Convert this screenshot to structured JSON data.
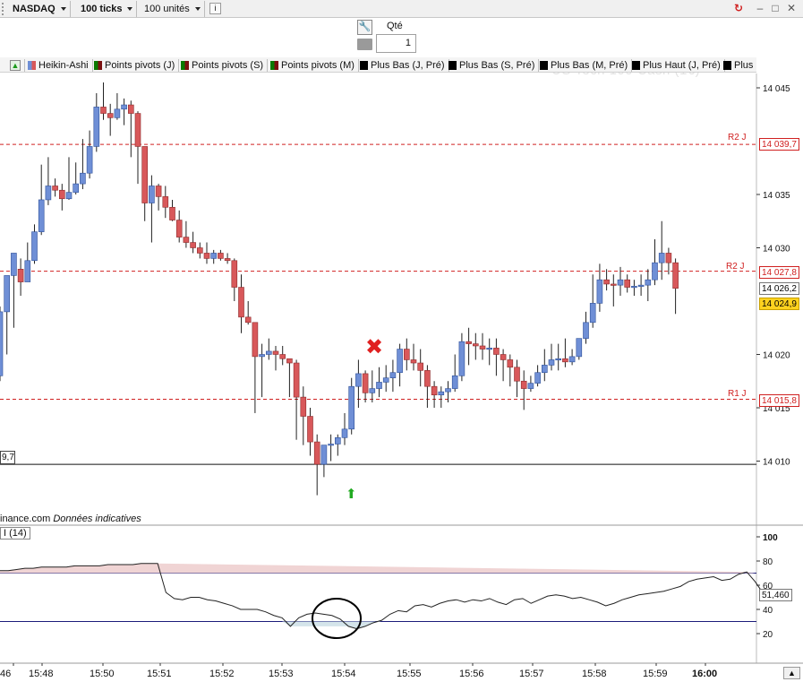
{
  "toolbar": {
    "instrument": "NASDAQ",
    "ticks": "100 ticks",
    "units": "100 unités"
  },
  "order_panel": {
    "qty_label": "Qté",
    "qty_value": "1"
  },
  "legend": {
    "items": [
      "Heikin-Ashi",
      "Points pivots (J)",
      "Points pivots (S)",
      "Points pivots (M)",
      "Plus Bas (J, Pré)",
      "Plus Bas (S, Pré)",
      "Plus Bas (M, Pré)",
      "Plus Haut (J, Pré)",
      "Plus"
    ]
  },
  "watermark": "US Tech 100 Cash (1€)",
  "source": {
    "site": "inance.com",
    "note": "Données indicatives"
  },
  "rsi_label": "I (14)",
  "left_value": "9,7",
  "chart_data": {
    "type": "candlestick",
    "price_axis": {
      "ticks": [
        "14 045",
        "14 035",
        "14 030",
        "14 020",
        "14 015",
        "14 010"
      ],
      "tick_values": [
        14045,
        14035,
        14030,
        14020,
        14015,
        14010
      ]
    },
    "pivots": [
      {
        "name": "R2 J",
        "value": 14039.7,
        "label": "14 039,7"
      },
      {
        "name": "R2 J",
        "value": 14027.8,
        "label": "14 027,8"
      },
      {
        "name": "R1 J",
        "value": 14015.8,
        "label": "14 015,8"
      }
    ],
    "horizontal_line": {
      "value": 14009.7
    },
    "last_price": {
      "value": 14024.9,
      "label": "14 024,9"
    },
    "prev_price": {
      "value": 14026.2,
      "label": "14 026,2"
    },
    "time_labels": [
      "46",
      "15:48",
      "15:50",
      "15:51",
      "15:52",
      "15:53",
      "15:54",
      "15:55",
      "15:56",
      "15:57",
      "15:58",
      "15:59",
      "16:00"
    ],
    "candles": [
      {
        "o": 14018.0,
        "h": 14024.5,
        "l": 14017.5,
        "c": 14024.0
      },
      {
        "o": 14024.0,
        "h": 14027.2,
        "l": 14020.0,
        "c": 14027.4
      },
      {
        "o": 14027.4,
        "h": 14029.5,
        "l": 14022.5,
        "c": 14029.5
      },
      {
        "o": 14028.0,
        "h": 14029.0,
        "l": 14025.5,
        "c": 14026.8
      },
      {
        "o": 14026.8,
        "h": 14030.5,
        "l": 14027.0,
        "c": 14028.8
      },
      {
        "o": 14028.8,
        "h": 14032.2,
        "l": 14028.5,
        "c": 14031.5
      },
      {
        "o": 14031.5,
        "h": 14037.8,
        "l": 14031.2,
        "c": 14034.5
      },
      {
        "o": 14034.5,
        "h": 14038.5,
        "l": 14034.0,
        "c": 14035.8
      },
      {
        "o": 14035.8,
        "h": 14036.5,
        "l": 14034.8,
        "c": 14035.4
      },
      {
        "o": 14035.4,
        "h": 14036.0,
        "l": 14033.5,
        "c": 14034.6
      },
      {
        "o": 14034.6,
        "h": 14038.5,
        "l": 14034.5,
        "c": 14035.2
      },
      {
        "o": 14035.2,
        "h": 14038.0,
        "l": 14035.0,
        "c": 14036.0
      },
      {
        "o": 14036.0,
        "h": 14040.2,
        "l": 14035.5,
        "c": 14037.0
      },
      {
        "o": 14037.0,
        "h": 14041.0,
        "l": 14036.5,
        "c": 14039.5
      },
      {
        "o": 14039.5,
        "h": 14044.5,
        "l": 14039.0,
        "c": 14043.2
      },
      {
        "o": 14043.2,
        "h": 14045.5,
        "l": 14042.0,
        "c": 14042.6
      },
      {
        "o": 14042.6,
        "h": 14043.5,
        "l": 14040.5,
        "c": 14042.2
      },
      {
        "o": 14042.2,
        "h": 14044.5,
        "l": 14042.0,
        "c": 14043.0
      },
      {
        "o": 14043.0,
        "h": 14044.0,
        "l": 14041.5,
        "c": 14043.4
      },
      {
        "o": 14043.4,
        "h": 14043.8,
        "l": 14038.5,
        "c": 14042.6
      },
      {
        "o": 14042.6,
        "h": 14042.8,
        "l": 14036.0,
        "c": 14039.5
      },
      {
        "o": 14039.5,
        "h": 14039.5,
        "l": 14032.5,
        "c": 14034.2
      },
      {
        "o": 14034.2,
        "h": 14036.8,
        "l": 14030.5,
        "c": 14035.8
      },
      {
        "o": 14035.8,
        "h": 14036.0,
        "l": 14033.5,
        "c": 14034.8
      },
      {
        "o": 14034.8,
        "h": 14035.8,
        "l": 14032.8,
        "c": 14033.8
      },
      {
        "o": 14033.8,
        "h": 14034.5,
        "l": 14032.5,
        "c": 14032.6
      },
      {
        "o": 14032.6,
        "h": 14033.5,
        "l": 14030.5,
        "c": 14031.0
      },
      {
        "o": 14031.0,
        "h": 14032.5,
        "l": 14030.0,
        "c": 14030.5
      },
      {
        "o": 14030.5,
        "h": 14031.5,
        "l": 14029.5,
        "c": 14030.0
      },
      {
        "o": 14030.0,
        "h": 14030.5,
        "l": 14029.0,
        "c": 14029.5
      },
      {
        "o": 14029.5,
        "h": 14030.5,
        "l": 14028.5,
        "c": 14029.0
      },
      {
        "o": 14029.0,
        "h": 14029.8,
        "l": 14028.5,
        "c": 14029.5
      },
      {
        "o": 14029.5,
        "h": 14029.8,
        "l": 14028.8,
        "c": 14029.0
      },
      {
        "o": 14029.0,
        "h": 14029.5,
        "l": 14028.5,
        "c": 14028.8
      },
      {
        "o": 14028.8,
        "h": 14029.0,
        "l": 14025.0,
        "c": 14026.3
      },
      {
        "o": 14026.3,
        "h": 14027.5,
        "l": 14022.0,
        "c": 14023.5
      },
      {
        "o": 14023.5,
        "h": 14025.0,
        "l": 14022.8,
        "c": 14023.0
      },
      {
        "o": 14023.0,
        "h": 14023.0,
        "l": 14014.5,
        "c": 14019.8
      },
      {
        "o": 14019.8,
        "h": 14021.0,
        "l": 14016.0,
        "c": 14020.0
      },
      {
        "o": 14020.0,
        "h": 14021.5,
        "l": 14019.5,
        "c": 14020.3
      },
      {
        "o": 14020.3,
        "h": 14020.8,
        "l": 14018.5,
        "c": 14020.0
      },
      {
        "o": 14020.0,
        "h": 14020.8,
        "l": 14019.0,
        "c": 14019.6
      },
      {
        "o": 14019.6,
        "h": 14019.6,
        "l": 14016.0,
        "c": 14019.2
      },
      {
        "o": 14019.2,
        "h": 14019.5,
        "l": 14012.0,
        "c": 14016.0
      },
      {
        "o": 14016.0,
        "h": 14017.0,
        "l": 14011.5,
        "c": 14014.2
      },
      {
        "o": 14014.2,
        "h": 14015.0,
        "l": 14010.5,
        "c": 14011.8
      },
      {
        "o": 14011.8,
        "h": 14012.5,
        "l": 14006.8,
        "c": 14009.7
      },
      {
        "o": 14009.7,
        "h": 14011.5,
        "l": 14008.5,
        "c": 14011.5
      },
      {
        "o": 14011.5,
        "h": 14012.5,
        "l": 14010.0,
        "c": 14011.6
      },
      {
        "o": 14011.6,
        "h": 14012.5,
        "l": 14010.5,
        "c": 14012.2
      },
      {
        "o": 14012.2,
        "h": 14014.5,
        "l": 14011.5,
        "c": 14013.0
      },
      {
        "o": 14013.0,
        "h": 14017.8,
        "l": 14012.5,
        "c": 14017.0
      },
      {
        "o": 14017.0,
        "h": 14019.5,
        "l": 14015.0,
        "c": 14018.2
      },
      {
        "o": 14018.2,
        "h": 14018.5,
        "l": 14015.5,
        "c": 14016.4
      },
      {
        "o": 14016.4,
        "h": 14018.5,
        "l": 14015.5,
        "c": 14016.8
      },
      {
        "o": 14016.8,
        "h": 14018.8,
        "l": 14016.0,
        "c": 14017.4
      },
      {
        "o": 14017.4,
        "h": 14019.0,
        "l": 14016.5,
        "c": 14017.8
      },
      {
        "o": 14017.8,
        "h": 14019.5,
        "l": 14016.5,
        "c": 14018.3
      },
      {
        "o": 14018.3,
        "h": 14021.0,
        "l": 14017.0,
        "c": 14020.5
      },
      {
        "o": 14020.5,
        "h": 14021.5,
        "l": 14018.5,
        "c": 14019.5
      },
      {
        "o": 14019.5,
        "h": 14021.0,
        "l": 14018.5,
        "c": 14019.2
      },
      {
        "o": 14019.2,
        "h": 14020.5,
        "l": 14017.0,
        "c": 14018.5
      },
      {
        "o": 14018.5,
        "h": 14019.0,
        "l": 14015.0,
        "c": 14017.0
      },
      {
        "o": 14017.0,
        "h": 14017.5,
        "l": 14015.0,
        "c": 14016.2
      },
      {
        "o": 14016.2,
        "h": 14017.0,
        "l": 14015.0,
        "c": 14016.5
      },
      {
        "o": 14016.5,
        "h": 14017.5,
        "l": 14015.5,
        "c": 14016.8
      },
      {
        "o": 14016.8,
        "h": 14020.0,
        "l": 14016.5,
        "c": 14018.0
      },
      {
        "o": 14018.0,
        "h": 14022.0,
        "l": 14017.5,
        "c": 14021.2
      },
      {
        "o": 14021.2,
        "h": 14022.5,
        "l": 14019.0,
        "c": 14021.0
      },
      {
        "o": 14021.0,
        "h": 14022.0,
        "l": 14019.5,
        "c": 14020.8
      },
      {
        "o": 14020.8,
        "h": 14022.0,
        "l": 14019.5,
        "c": 14020.5
      },
      {
        "o": 14020.5,
        "h": 14021.5,
        "l": 14019.0,
        "c": 14020.6
      },
      {
        "o": 14020.6,
        "h": 14021.5,
        "l": 14018.0,
        "c": 14020.0
      },
      {
        "o": 14020.0,
        "h": 14020.5,
        "l": 14017.5,
        "c": 14019.5
      },
      {
        "o": 14019.5,
        "h": 14020.0,
        "l": 14017.0,
        "c": 14018.8
      },
      {
        "o": 14018.8,
        "h": 14019.5,
        "l": 14016.0,
        "c": 14017.5
      },
      {
        "o": 14017.5,
        "h": 14018.5,
        "l": 14014.8,
        "c": 14016.8
      },
      {
        "o": 14016.8,
        "h": 14018.0,
        "l": 14016.5,
        "c": 14017.3
      },
      {
        "o": 14017.3,
        "h": 14019.0,
        "l": 14017.0,
        "c": 14018.3
      },
      {
        "o": 14018.3,
        "h": 14020.5,
        "l": 14017.5,
        "c": 14019.0
      },
      {
        "o": 14019.0,
        "h": 14021.0,
        "l": 14018.5,
        "c": 14019.5
      },
      {
        "o": 14019.5,
        "h": 14021.0,
        "l": 14018.5,
        "c": 14019.6
      },
      {
        "o": 14019.6,
        "h": 14021.5,
        "l": 14018.8,
        "c": 14019.3
      },
      {
        "o": 14019.3,
        "h": 14020.5,
        "l": 14019.0,
        "c": 14019.8
      },
      {
        "o": 14019.8,
        "h": 14021.5,
        "l": 14019.5,
        "c": 14021.5
      },
      {
        "o": 14021.5,
        "h": 14024.0,
        "l": 14021.0,
        "c": 14023.0
      },
      {
        "o": 14023.0,
        "h": 14027.5,
        "l": 14022.5,
        "c": 14024.8
      },
      {
        "o": 14024.8,
        "h": 14028.5,
        "l": 14024.0,
        "c": 14027.0
      },
      {
        "o": 14027.0,
        "h": 14028.0,
        "l": 14026.0,
        "c": 14026.6
      },
      {
        "o": 14026.6,
        "h": 14027.5,
        "l": 14024.5,
        "c": 14026.5
      },
      {
        "o": 14026.5,
        "h": 14028.2,
        "l": 14025.5,
        "c": 14027.0
      },
      {
        "o": 14027.0,
        "h": 14027.5,
        "l": 14025.8,
        "c": 14026.3
      },
      {
        "o": 14026.3,
        "h": 14027.0,
        "l": 14025.5,
        "c": 14026.4
      },
      {
        "o": 14026.4,
        "h": 14027.5,
        "l": 14025.5,
        "c": 14026.5
      },
      {
        "o": 14026.5,
        "h": 14028.0,
        "l": 14025.0,
        "c": 14027.0
      },
      {
        "o": 14027.0,
        "h": 14030.8,
        "l": 14026.5,
        "c": 14028.6
      },
      {
        "o": 14028.6,
        "h": 14032.5,
        "l": 14027.0,
        "c": 14029.5
      },
      {
        "o": 14029.5,
        "h": 14030.0,
        "l": 14027.5,
        "c": 14028.6
      },
      {
        "o": 14028.6,
        "h": 14029.0,
        "l": 14023.8,
        "c": 14026.2
      }
    ],
    "rsi": {
      "period": 14,
      "ticks": [
        100,
        80,
        60,
        40,
        20
      ],
      "upper": 70,
      "lower": 30,
      "value_label": "51,460",
      "values": [
        72,
        72,
        73,
        74,
        74,
        75,
        75,
        75,
        75,
        76,
        76,
        76,
        76,
        77,
        77,
        77,
        77,
        78,
        78,
        78,
        54,
        49,
        48,
        50,
        50,
        48,
        47,
        45,
        43,
        40,
        40,
        40,
        38,
        35,
        33,
        26,
        33,
        36,
        37,
        36,
        35,
        32,
        26,
        24,
        26,
        29,
        31,
        36,
        39,
        38,
        43,
        44,
        42,
        45,
        47,
        48,
        46,
        48,
        47,
        49,
        46,
        44,
        48,
        49,
        45,
        48,
        51,
        52,
        51,
        49,
        50,
        48,
        46,
        43,
        45,
        48,
        50,
        52,
        53,
        54,
        55,
        57,
        59,
        63,
        65,
        66,
        67,
        64,
        65,
        69,
        71,
        63,
        53
      ]
    },
    "annotations": [
      {
        "type": "sell-marker",
        "symbol": "✖"
      },
      {
        "type": "buy-marker",
        "symbol": "⬆"
      }
    ],
    "colors": {
      "bull": "#6f8fd6",
      "bear": "#d8585a",
      "pivot": "#d02020",
      "rsi_overbought_fill": "#f0d4d4",
      "rsi_oversold_fill": "#d4e4ea"
    }
  }
}
